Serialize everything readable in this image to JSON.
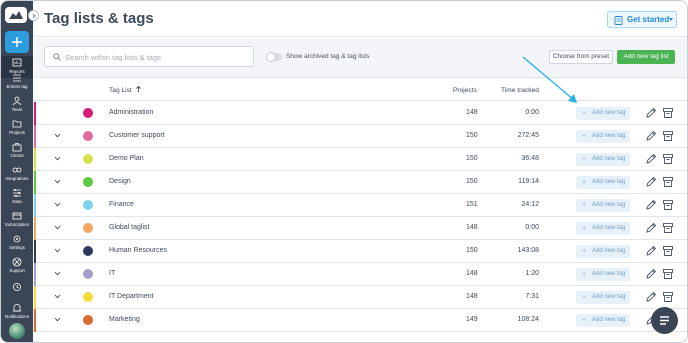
{
  "app": {
    "page_title": "Tag lists & tags",
    "get_started_label": "Get started"
  },
  "sidebar": {
    "items": [
      {
        "label": "Reports",
        "icon": "reports-icon"
      },
      {
        "label": "Entries tag",
        "icon": "entries-icon"
      },
      {
        "label": "Team",
        "icon": "team-icon"
      },
      {
        "label": "Projects",
        "icon": "projects-icon"
      },
      {
        "label": "Clients",
        "icon": "clients-icon"
      },
      {
        "label": "Integrations",
        "icon": "integrations-icon"
      },
      {
        "label": "Data",
        "icon": "data-icon"
      },
      {
        "label": "Subscription",
        "icon": "subscription-icon"
      },
      {
        "label": "Settings",
        "icon": "settings-icon"
      },
      {
        "label": "Support",
        "icon": "support-icon"
      },
      {
        "label": "",
        "icon": "history-icon"
      },
      {
        "label": "Notifications",
        "icon": "bell-icon"
      }
    ]
  },
  "toolbar": {
    "search_placeholder": "Search within tag lists & tags",
    "archived_toggle_label": "Show archived tag & tag lists",
    "preset_button": "Choose from preset",
    "new_list_button": "Add new tag list"
  },
  "table": {
    "columns": {
      "name": "Tag List",
      "projects": "Projects",
      "time": "Time tracked"
    },
    "add_tag_label": "Add new tag",
    "rows": [
      {
        "name": "Administration",
        "projects": "148",
        "time": "0:00",
        "color": "#d81b7c",
        "bar": "#d81b7c",
        "expandable": false
      },
      {
        "name": "Customer support",
        "projects": "150",
        "time": "272:45",
        "color": "#e56a9a",
        "bar": "#e56a9a",
        "expandable": true
      },
      {
        "name": "Demo Plan",
        "projects": "150",
        "time": "36:48",
        "color": "#d5e04a",
        "bar": "#d5e04a",
        "expandable": true
      },
      {
        "name": "Design",
        "projects": "150",
        "time": "119:14",
        "color": "#5ac93c",
        "bar": "#5ac93c",
        "expandable": true
      },
      {
        "name": "Finance",
        "projects": "151",
        "time": "24:12",
        "color": "#7fd3ec",
        "bar": "#7fd3ec",
        "expandable": true
      },
      {
        "name": "Global taglist",
        "projects": "148",
        "time": "0:00",
        "color": "#f2a65e",
        "bar": "#f2a65e",
        "expandable": true
      },
      {
        "name": "Human Resources",
        "projects": "150",
        "time": "143:08",
        "color": "#2f3b5e",
        "bar": "#2f3b5e",
        "expandable": true
      },
      {
        "name": "IT",
        "projects": "148",
        "time": "1:20",
        "color": "#a79fcd",
        "bar": "#a79fcd",
        "expandable": true
      },
      {
        "name": "IT Department",
        "projects": "148",
        "time": "7:31",
        "color": "#f4dc3a",
        "bar": "#f4dc3a",
        "expandable": true
      },
      {
        "name": "Marketing",
        "projects": "149",
        "time": "108:24",
        "color": "#de6a32",
        "bar": "#de6a32",
        "expandable": true
      }
    ]
  },
  "colors": {
    "sidebar": "#3a4556",
    "accent_blue": "#2e9de0",
    "accent_green": "#4ab353",
    "annotation_arrow": "#2bb3e8"
  }
}
